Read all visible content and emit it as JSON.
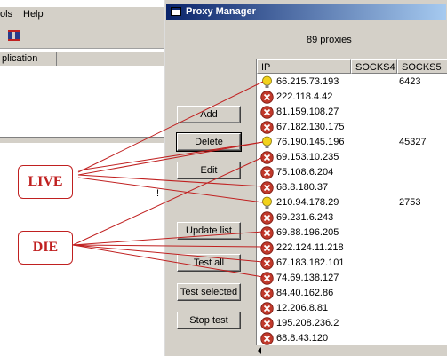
{
  "background_app": {
    "menu": {
      "tools_partial": "ols",
      "help": "Help"
    },
    "list_header": {
      "col_application_partial": "plication"
    },
    "exclamation": "!"
  },
  "proxy_manager": {
    "title": "Proxy Manager",
    "proxy_count": "89 proxies",
    "buttons": {
      "add": "Add",
      "delete": "Delete",
      "edit": "Edit",
      "update_list": "Update list",
      "test_all": "Test all",
      "test_selected": "Test selected",
      "stop_test": "Stop test"
    },
    "columns": {
      "ip": "IP",
      "socks4": "SOCKS4",
      "socks5": "SOCKS5"
    },
    "rows": [
      {
        "status": "live",
        "ip": "66.215.73.193",
        "socks5": "6423"
      },
      {
        "status": "dead",
        "ip": "222.118.4.42",
        "socks5": ""
      },
      {
        "status": "dead",
        "ip": "81.159.108.27",
        "socks5": ""
      },
      {
        "status": "dead",
        "ip": "67.182.130.175",
        "socks5": ""
      },
      {
        "status": "live",
        "ip": "76.190.145.196",
        "socks5": "45327"
      },
      {
        "status": "dead",
        "ip": "69.153.10.235",
        "socks5": ""
      },
      {
        "status": "dead",
        "ip": "75.108.6.204",
        "socks5": ""
      },
      {
        "status": "dead",
        "ip": "68.8.180.37",
        "socks5": ""
      },
      {
        "status": "live",
        "ip": "210.94.178.29",
        "socks5": "2753"
      },
      {
        "status": "dead",
        "ip": "69.231.6.243",
        "socks5": ""
      },
      {
        "status": "dead",
        "ip": "69.88.196.205",
        "socks5": ""
      },
      {
        "status": "dead",
        "ip": "222.124.11.218",
        "socks5": ""
      },
      {
        "status": "dead",
        "ip": "67.183.182.101",
        "socks5": ""
      },
      {
        "status": "dead",
        "ip": "74.69.138.127",
        "socks5": ""
      },
      {
        "status": "dead",
        "ip": "84.40.162.86",
        "socks5": ""
      },
      {
        "status": "dead",
        "ip": "12.206.8.81",
        "socks5": ""
      },
      {
        "status": "dead",
        "ip": "195.208.236.2",
        "socks5": ""
      },
      {
        "status": "dead",
        "ip": "68.8.43.120",
        "socks5": ""
      }
    ]
  },
  "annotations": {
    "live_label": "LIVE",
    "die_label": "DIE",
    "color": "#c02020"
  },
  "colors": {
    "titlebar_start": "#0a246a",
    "titlebar_end": "#a6caf0",
    "window_face": "#d4d0c8",
    "dead_icon": "#c0392b",
    "live_icon": "#f2d21b"
  }
}
